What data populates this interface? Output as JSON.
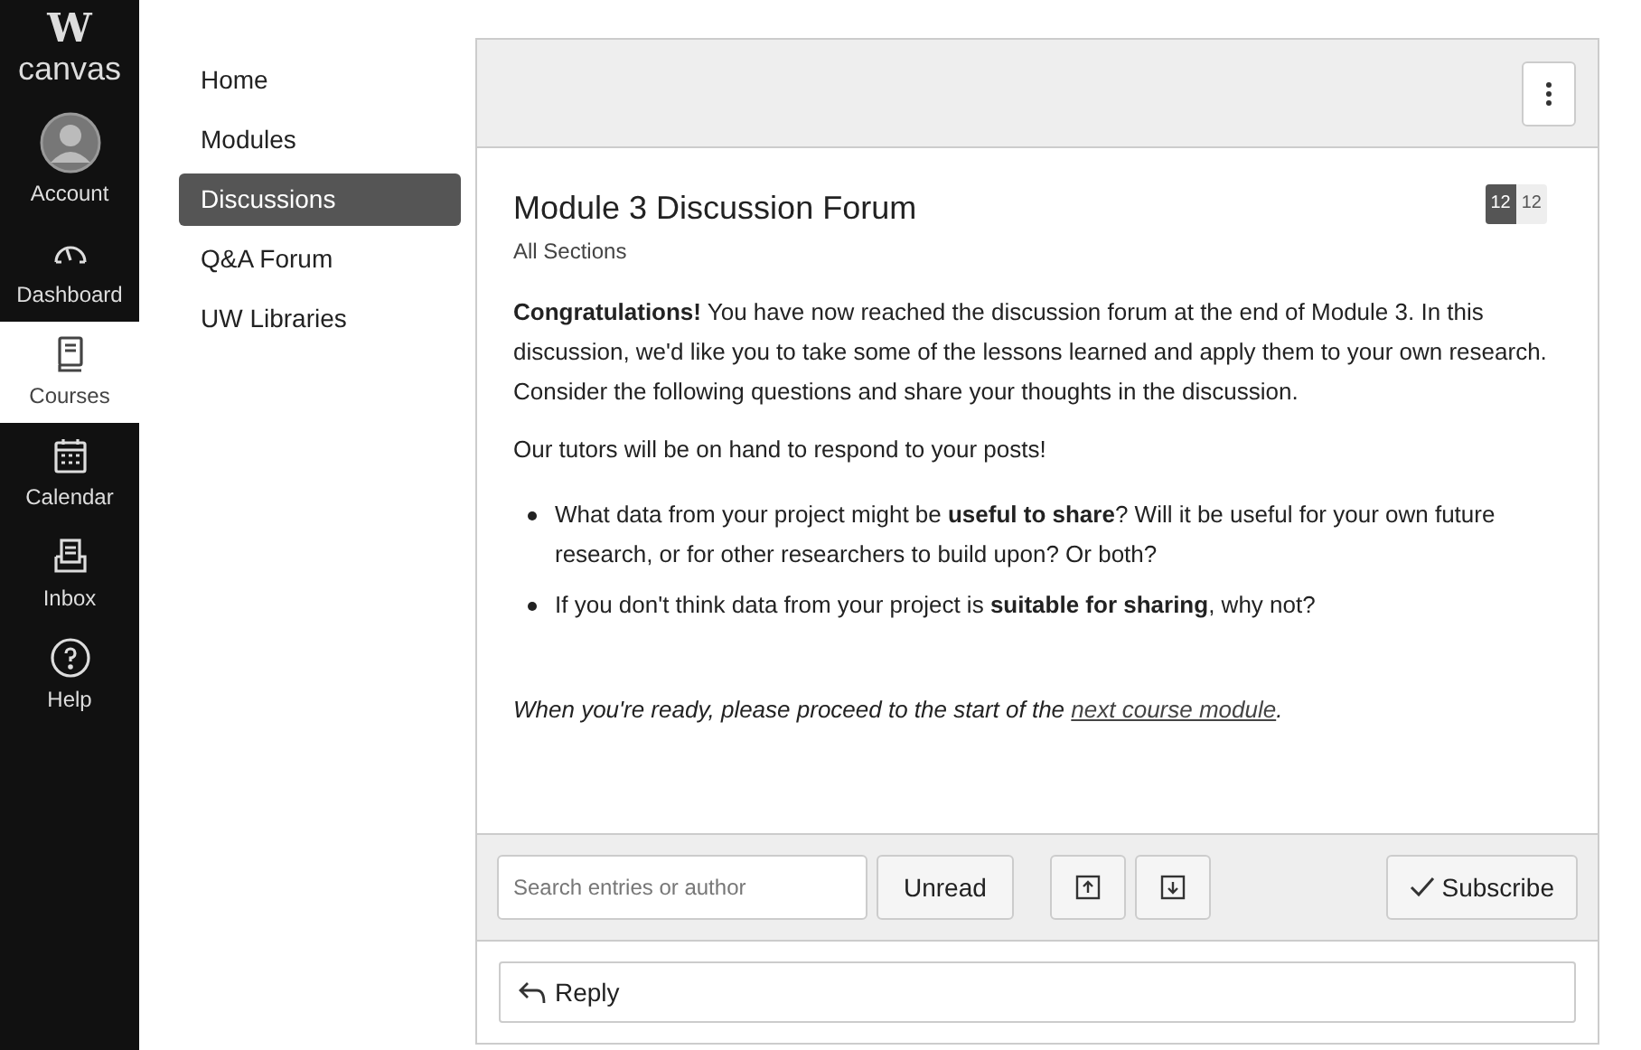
{
  "global_nav": {
    "logo_letter": "W",
    "logo_text": "canvas",
    "items": [
      {
        "label": "Account",
        "kind": "account",
        "selected": false
      },
      {
        "label": "Dashboard",
        "kind": "dashboard",
        "selected": false
      },
      {
        "label": "Courses",
        "kind": "courses",
        "selected": true
      },
      {
        "label": "Calendar",
        "kind": "calendar",
        "selected": false
      },
      {
        "label": "Inbox",
        "kind": "inbox",
        "selected": false
      },
      {
        "label": "Help",
        "kind": "help",
        "selected": false
      }
    ]
  },
  "course_nav": [
    {
      "label": "Home",
      "selected": false
    },
    {
      "label": "Modules",
      "selected": false
    },
    {
      "label": "Discussions",
      "selected": true
    },
    {
      "label": "Q&A Forum",
      "selected": false
    },
    {
      "label": "UW Libraries",
      "selected": false
    }
  ],
  "discussion": {
    "title": "Module 3 Discussion Forum",
    "sections": "All Sections",
    "unread_count": "12",
    "total_count": "12",
    "paragraphs": [
      "**Congratulations!** You have now reached the discussion forum at the end of Module 3. In this discussion, we'd like you to take some of the lessons learned and apply them to your own research. Consider the following questions and share your thoughts in the discussion.",
      "Our tutors will be on hand to respond to your posts!"
    ],
    "bullets": [
      "What data from your project might be **useful to share**? Will it be useful for your own future research, or for other researchers to build upon? Or both?",
      "If you don't think data from your project is **suitable for sharing**, why not?"
    ],
    "closing": {
      "before": "When you're ready, please proceed to the start of the ",
      "link": "next course module",
      "after": "."
    }
  },
  "toolbar": {
    "search_placeholder": "Search entries or author",
    "unread_button": "Unread",
    "subscribe_button": "Subscribe"
  },
  "reply_button": "Reply"
}
